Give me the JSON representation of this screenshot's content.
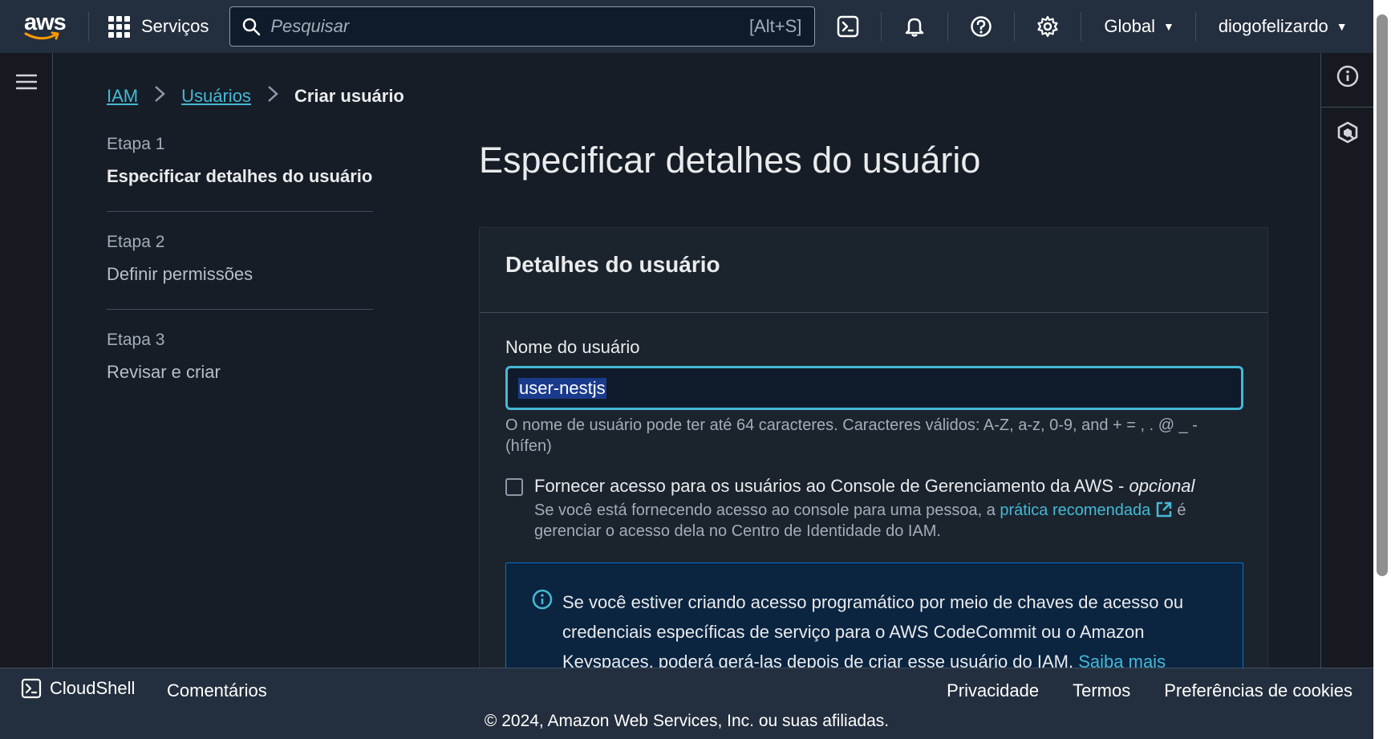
{
  "topnav": {
    "logo_text": "aws",
    "services_label": "Serviços",
    "search_placeholder": "Pesquisar",
    "search_shortcut": "[Alt+S]",
    "region_label": "Global",
    "account_label": "diogofelizardo"
  },
  "breadcrumb": {
    "items": [
      "IAM",
      "Usuários"
    ],
    "current": "Criar usuário"
  },
  "steps": [
    {
      "label": "Etapa 1",
      "name": "Especificar detalhes do usuário",
      "active": true
    },
    {
      "label": "Etapa 2",
      "name": "Definir permissões",
      "active": false
    },
    {
      "label": "Etapa 3",
      "name": "Revisar e criar",
      "active": false
    }
  ],
  "page": {
    "title": "Especificar detalhes do usuário"
  },
  "card": {
    "title": "Detalhes do usuário",
    "username_label": "Nome do usuário",
    "username_value": "user-nestjs",
    "username_hint": "O nome de usuário pode ter até 64 caracteres. Caracteres válidos: A-Z, a-z, 0-9, and + = , . @ _ - (hífen)",
    "console_checkbox": {
      "title": "Fornecer acesso para os usuários ao Console de Gerenciamento da AWS - ",
      "title_optional": "opcional",
      "desc_before": "Se você está fornecendo acesso ao console para uma pessoa, a ",
      "desc_link": "prática recomendada",
      "desc_after": " é gerenciar o acesso dela no Centro de Identidade do IAM.",
      "checked": false
    },
    "info_box": {
      "text": "Se você estiver criando acesso programático por meio de chaves de acesso ou credenciais específicas de serviço para o AWS CodeCommit ou o Amazon Keyspaces, poderá gerá-las depois de criar esse usuário do IAM. ",
      "link": "Saiba mais"
    }
  },
  "footer": {
    "cloudshell_label": "CloudShell",
    "comments_label": "Comentários",
    "privacy_label": "Privacidade",
    "terms_label": "Termos",
    "cookies_label": "Preferências de cookies",
    "copyright": "© 2024, Amazon Web Services, Inc. ou suas afiliadas."
  },
  "colors": {
    "accent_link": "#44b9d6",
    "nav_bg": "#232f3e",
    "info_border": "#0972d3",
    "aws_orange": "#ff9900"
  }
}
